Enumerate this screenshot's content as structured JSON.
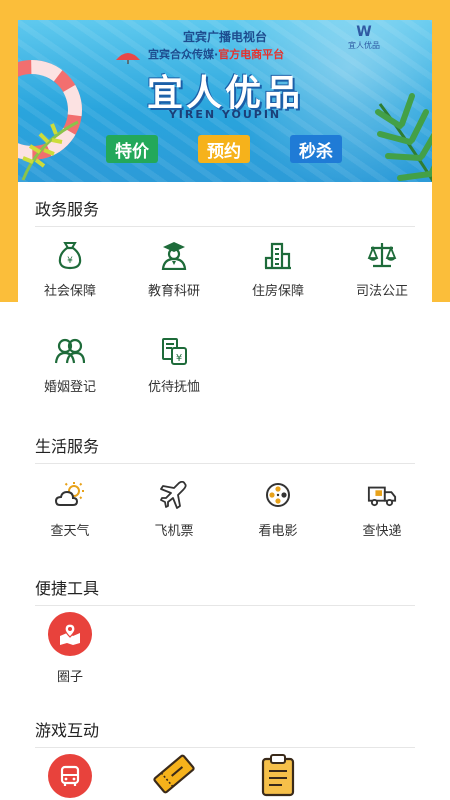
{
  "banner": {
    "top_text": "宜宾广播电视台",
    "line2_prefix": "宜宾合众传媒·",
    "line2_highlight": "官方电商平台",
    "logo_mark": "W",
    "logo_text": "宜人优品",
    "title": "宜人优品",
    "subtitle": "YIREN YOUPIN",
    "tags": [
      "特价",
      "预约",
      "秒杀"
    ],
    "colors": {
      "tag_green": "#23A85A",
      "tag_yellow": "#F6B21B",
      "tag_blue": "#1F7BD6"
    }
  },
  "government": {
    "title": "政务服务",
    "items": [
      {
        "label": "社会保障",
        "icon": "money-bag-icon"
      },
      {
        "label": "教育科研",
        "icon": "graduate-icon"
      },
      {
        "label": "住房保障",
        "icon": "building-icon"
      },
      {
        "label": "司法公正",
        "icon": "scales-icon"
      },
      {
        "label": "婚姻登记",
        "icon": "couple-icon"
      },
      {
        "label": "优待抚恤",
        "icon": "money-document-icon"
      }
    ]
  },
  "life": {
    "title": "生活服务",
    "items": [
      {
        "label": "查天气",
        "icon": "weather-icon"
      },
      {
        "label": "飞机票",
        "icon": "airplane-icon"
      },
      {
        "label": "看电影",
        "icon": "film-reel-icon"
      },
      {
        "label": "查快递",
        "icon": "delivery-truck-icon"
      }
    ]
  },
  "tools": {
    "title": "便捷工具",
    "items": [
      {
        "label": "圈子",
        "icon": "circle-map-icon"
      }
    ]
  },
  "games": {
    "title": "游戏互动",
    "items": [
      {
        "icon": "bus-icon"
      },
      {
        "icon": "ticket-icon"
      },
      {
        "icon": "clipboard-icon"
      }
    ]
  },
  "colors": {
    "accent_yellow": "#FBBE3A",
    "icon_green": "#1E6B3A",
    "icon_red": "#E8423C"
  }
}
